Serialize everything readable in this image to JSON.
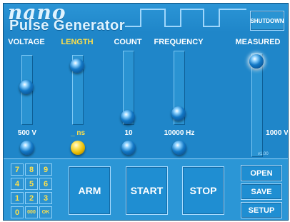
{
  "app": {
    "logo_text": "nano",
    "title": "Pulse Generator",
    "version": "v1.00"
  },
  "header": {
    "shutdown_label": "SHUTDOWN"
  },
  "channels": [
    {
      "name": "voltage",
      "label": "VOLTAGE",
      "value": "500 V",
      "active": false,
      "slider_level": 0.55
    },
    {
      "name": "length",
      "label": "LENGTH",
      "value": "_ ns",
      "active": true,
      "slider_level": 0.9
    },
    {
      "name": "count",
      "label": "COUNT",
      "value": "10",
      "active": false,
      "slider_level": 0.05
    },
    {
      "name": "frequency",
      "label": "FREQUENCY",
      "value": "10000 Hz",
      "active": false,
      "slider_level": 0.1
    }
  ],
  "measured": {
    "label": "MEASURED",
    "value": "1000 V",
    "level": 0.97
  },
  "keypad": {
    "keys": [
      "7",
      "8",
      "9",
      "4",
      "5",
      "6",
      "1",
      "2",
      "3",
      "0",
      "000",
      "OK"
    ]
  },
  "actions": {
    "arm": "ARM",
    "start": "START",
    "stop": "STOP"
  },
  "side_buttons": {
    "open": "OPEN",
    "save": "SAVE",
    "setup": "SETUP"
  },
  "colors": {
    "background": "#1f86c9",
    "accent_yellow": "#ffe04a",
    "text_white": "#ffffff"
  }
}
